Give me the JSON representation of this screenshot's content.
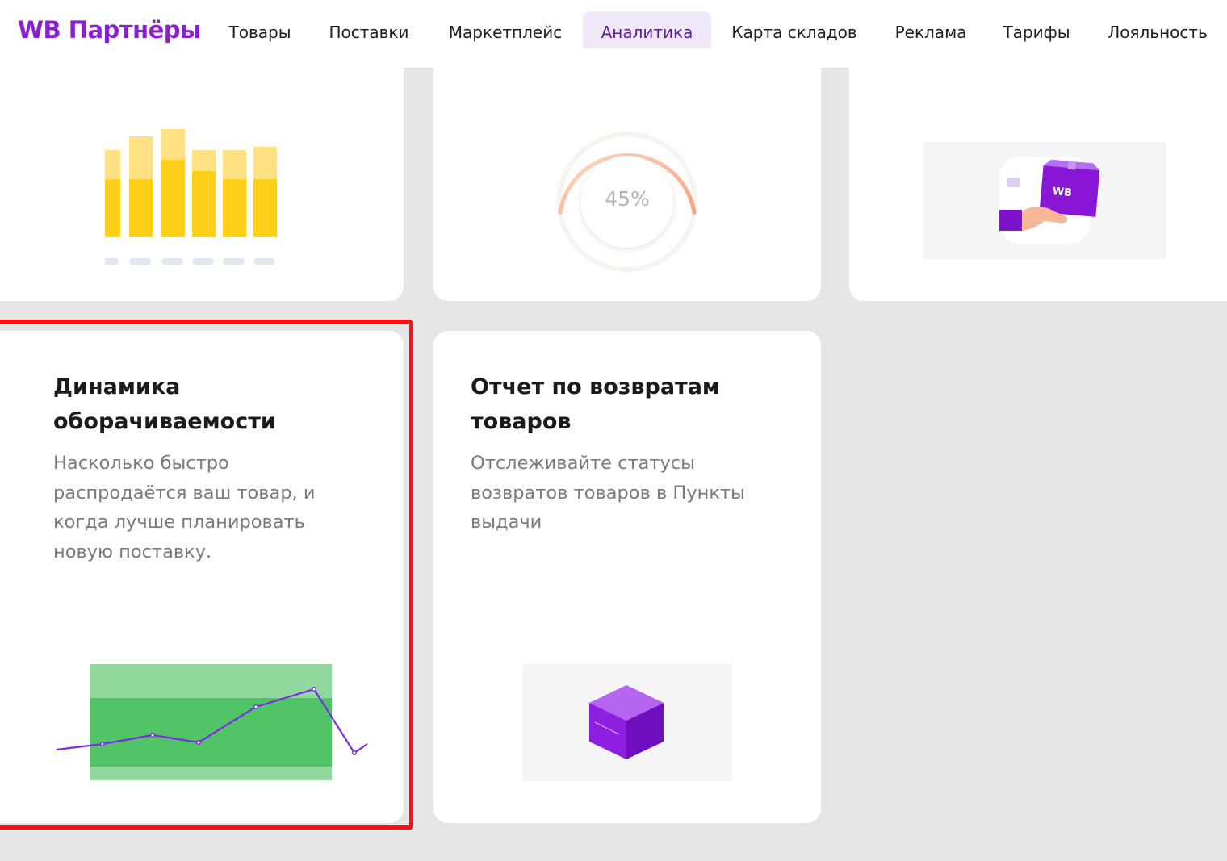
{
  "header": {
    "logo": "WB Партнёры",
    "nav": [
      {
        "label": "Товары",
        "active": false
      },
      {
        "label": "Поставки",
        "active": false
      },
      {
        "label": "Маркетплейс",
        "active": false
      },
      {
        "label": "Аналитика",
        "active": true
      },
      {
        "label": "Карта складов",
        "active": false
      },
      {
        "label": "Реклама",
        "active": false
      },
      {
        "label": "Тарифы",
        "active": false
      },
      {
        "label": "Лояльность",
        "active": false
      }
    ]
  },
  "cards_top": [
    {
      "illustration": "bar-chart-icon"
    },
    {
      "illustration": "progress-ring-icon",
      "percent_label": "45%",
      "progress": 0.45
    },
    {
      "illustration": "hand-with-wb-box-icon",
      "box_label": "WB"
    }
  ],
  "cards_bottom": [
    {
      "title": "Динамика оборачиваемости",
      "title_lines": [
        "Динамика",
        "оборачиваемости"
      ],
      "description": "Насколько быстро распродаётся ваш товар, и когда лучше планировать новую поставку.",
      "description_lines": [
        "Насколько быстро",
        "распродаётся ваш товар, и",
        "когда лучше планировать",
        "новую поставку."
      ],
      "illustration": "line-chart-icon",
      "highlighted": true
    },
    {
      "title": "Отчет по возвратам товаров",
      "title_lines": [
        "Отчет по возвратам",
        "товаров"
      ],
      "description": "Отслеживайте статусы возвратов товаров в Пункты выдачи",
      "description_lines": [
        "Отслеживайте статусы",
        "возвратов товаров в Пункты",
        "выдачи"
      ],
      "illustration": "box-icon",
      "highlighted": false
    }
  ],
  "colors": {
    "brand": "#8b1fd6",
    "active_tab_bg": "#f0e8f7",
    "highlight_border": "#ff0f0f",
    "bar_light": "#ffe083",
    "bar_dark": "#ffcf1a",
    "chart_green": "#52c468",
    "line_purple": "#7d2be0"
  }
}
